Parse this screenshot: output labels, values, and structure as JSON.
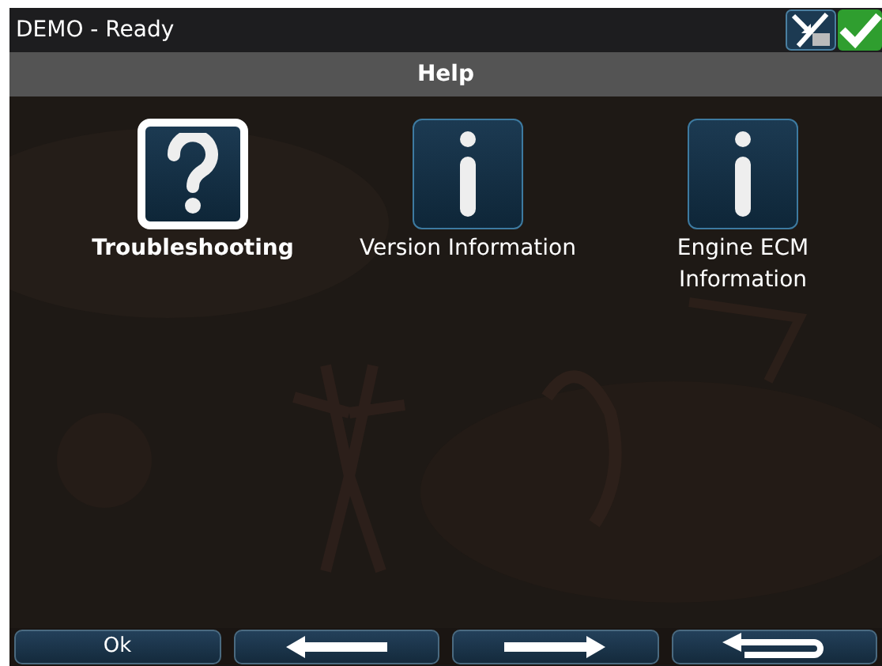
{
  "window": {
    "title": "DEMO - Ready"
  },
  "header": {
    "title": "Help"
  },
  "items": [
    {
      "kind": "question",
      "label": "Troubleshooting",
      "selected": true
    },
    {
      "kind": "info",
      "label": "Version Information",
      "selected": false
    },
    {
      "kind": "info",
      "label": "Engine ECM Information",
      "selected": false
    }
  ],
  "buttons": [
    {
      "kind": "text",
      "label": "Ok"
    },
    {
      "kind": "left"
    },
    {
      "kind": "right"
    },
    {
      "kind": "return"
    }
  ]
}
